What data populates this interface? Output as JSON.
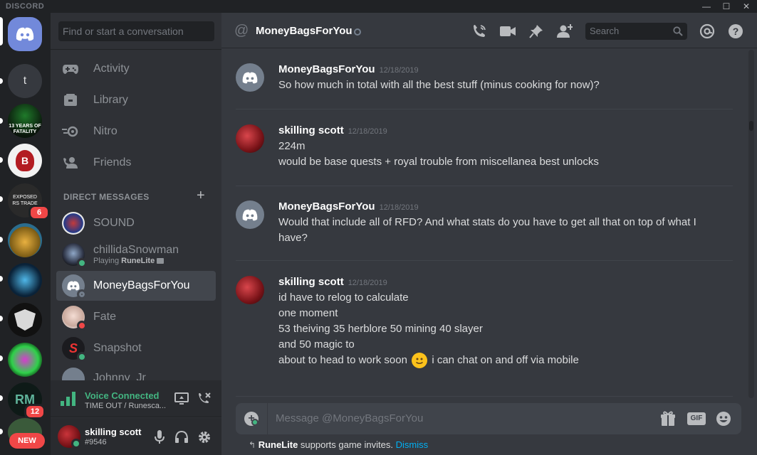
{
  "window": {
    "brand": "DISCORD",
    "controls": [
      "—",
      "☐",
      "✕"
    ]
  },
  "servers": [
    {
      "name": "home",
      "icon": "discord-logo-icon"
    },
    {
      "name": "t",
      "label": "t"
    },
    {
      "name": "13 years of fatality",
      "label": "13 YEARS OF FATALITY"
    },
    {
      "name": "b-server",
      "label": "B"
    },
    {
      "name": "exposed-rs-traders",
      "label": "EXPOSED RS TRADE",
      "badge": "6"
    },
    {
      "name": "treasure-chest"
    },
    {
      "name": "lucky"
    },
    {
      "name": "shield-server"
    },
    {
      "name": "green-server"
    },
    {
      "name": "rm-server",
      "label": "RM",
      "badge": "12"
    },
    {
      "name": "new-server",
      "label": "NEW"
    }
  ],
  "sidebar": {
    "search_placeholder": "Find or start a conversation",
    "nav": [
      {
        "label": "Activity",
        "icon": "gamepad-icon"
      },
      {
        "label": "Library",
        "icon": "library-icon"
      },
      {
        "label": "Nitro",
        "icon": "nitro-icon"
      },
      {
        "label": "Friends",
        "icon": "friends-icon"
      }
    ],
    "dm_header": "DIRECT MESSAGES",
    "dm_add": "+",
    "dms": [
      {
        "name": "SOUND",
        "status": "none"
      },
      {
        "name": "chillidaSnowman",
        "sub_prefix": "Playing ",
        "sub_game": "RuneLite",
        "status": "online"
      },
      {
        "name": "MoneyBagsForYou",
        "status": "offline",
        "active": true
      },
      {
        "name": "Fate",
        "status": "dnd"
      },
      {
        "name": "Snapshot",
        "status": "online"
      },
      {
        "name": "Johnny_Jr",
        "status": "none"
      }
    ],
    "voice": {
      "title": "Voice Connected",
      "channel": "TIME OUT / Runesca..."
    },
    "user": {
      "name": "skilling scott",
      "tag": "#9546"
    }
  },
  "header": {
    "at": "@",
    "name": "MoneyBagsForYou",
    "search_placeholder": "Search"
  },
  "messages": [
    {
      "author": "MoneyBagsForYou",
      "time": "12/18/2019",
      "lines": [
        "So how much in total with all the best stuff (minus cooking for now)?"
      ]
    },
    {
      "author": "skilling scott",
      "time": "12/18/2019",
      "lines": [
        "224m",
        "would be base quests + royal trouble from miscellanea best unlocks"
      ]
    },
    {
      "author": "MoneyBagsForYou",
      "time": "12/18/2019",
      "lines": [
        "Would that include all of RFD? And what stats do you have to get all that on top of what I",
        "have?"
      ]
    },
    {
      "author": "skilling scott",
      "time": "12/18/2019",
      "lines": [
        "id have to relog to calculate",
        "one moment",
        "53 theiving 35 herblore 50 mining 40 slayer",
        "and 50 magic to",
        "about to head to work soon",
        "i can chat on and off via mobile"
      ]
    }
  ],
  "composer": {
    "placeholder": "Message @MoneyBagsForYou",
    "gif_label": "GIF"
  },
  "hint": {
    "app": "RuneLite",
    "text": " supports game invites. ",
    "dismiss": "Dismiss"
  },
  "colors": {
    "online": "#43b581",
    "dnd": "#f04747",
    "offline": "#747f8d",
    "link": "#00b0f4",
    "badge": "#f04747"
  }
}
